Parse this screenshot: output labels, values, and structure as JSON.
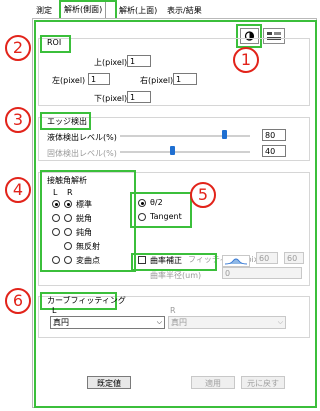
{
  "tabs": [
    "測定",
    "解析(側面)",
    "解析(上面)",
    "表示/結果"
  ],
  "roi": {
    "title": "ROI",
    "top_label": "上(pixel)",
    "top_value": "1",
    "left_label": "左(pixel)",
    "left_value": "1",
    "right_label": "右(pixel)",
    "right_value": "1",
    "bottom_label": "下(pixel)",
    "bottom_value": "1"
  },
  "edge": {
    "title": "エッジ検出",
    "liquid_label": "液体検出レベル(%)",
    "liquid_value": "80",
    "liquid_level": 80,
    "solid_label": "固体検出レベル(%)",
    "solid_value": "40",
    "solid_level": 40
  },
  "contact": {
    "title": "接触角解析",
    "col_l": "L",
    "col_r": "R",
    "rows": [
      "標準",
      "鋭角",
      "鈍角",
      "無反射",
      "変曲点"
    ],
    "method_theta": "θ/2",
    "method_tangent": "Tangent",
    "fit_label": "フィッティング(pixel)",
    "fit_value1": "60",
    "fit_value2": "60",
    "curvature_check_label": "曲率補正",
    "curvature_label": "曲率半径(um)",
    "curvature_value": "0"
  },
  "curve": {
    "title": "カーブフィッティング",
    "l_label": "L",
    "r_label": "R",
    "l_value": "真円",
    "r_value": "真円"
  },
  "buttons": {
    "default": "既定値",
    "apply": "適用",
    "revert": "元に戻す"
  },
  "markers": [
    "1",
    "2",
    "3",
    "4",
    "5",
    "6"
  ],
  "colors": {
    "highlight": "#3bbf3b",
    "marker": "#e2231a",
    "slider_thumb": "#1f6fd1"
  },
  "icons": [
    "contrast-icon",
    "layout-icon",
    "graph-preview-icon"
  ]
}
